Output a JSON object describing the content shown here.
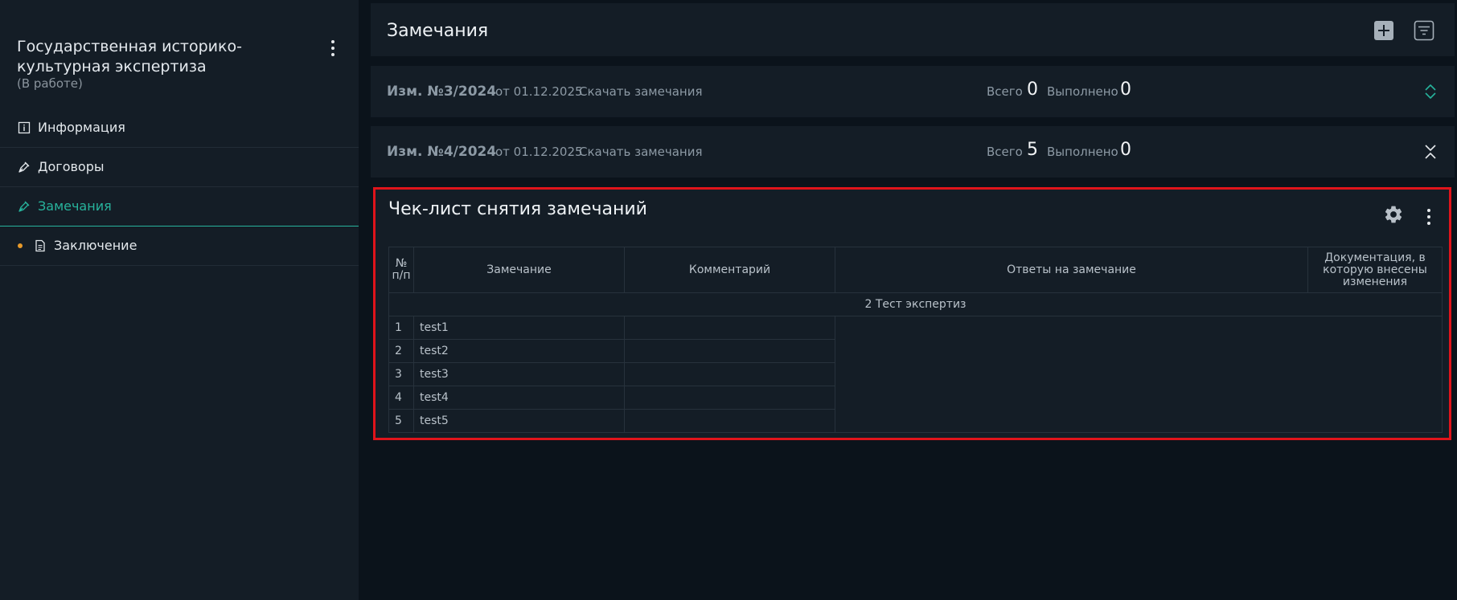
{
  "sidebar": {
    "title": "Государственная историко-культурная экспертиза",
    "status": "(В работе)",
    "menu_icon": "more-vertical-icon",
    "items": [
      {
        "label": "Информация",
        "icon": "info-icon"
      },
      {
        "label": "Договоры",
        "icon": "pen-icon"
      },
      {
        "label": "Замечания",
        "icon": "pen-icon",
        "active": true
      },
      {
        "label": "Заключение",
        "icon": "document-icon",
        "badge_color": "#e79a2a"
      }
    ]
  },
  "header": {
    "title": "Замечания",
    "add_icon": "plus-icon",
    "filter_icon": "filter-icon"
  },
  "revisions": [
    {
      "number": "Изм. №3/2024",
      "date": "от 01.12.2025",
      "download_label": "Скачать замечания",
      "total_label": "Всего",
      "total": "0",
      "done_label": "Выполнено",
      "done": "0",
      "toggle_icon": "expand-icon"
    },
    {
      "number": "Изм. №4/2024",
      "date": "от 01.12.2025",
      "download_label": "Скачать замечания",
      "total_label": "Всего",
      "total": "5",
      "done_label": "Выполнено",
      "done": "0",
      "toggle_icon": "collapse-icon"
    }
  ],
  "checklist": {
    "title": "Чек-лист снятия замечаний",
    "settings_icon": "gear-icon",
    "more_icon": "more-vertical-icon",
    "columns": [
      "№ п/п",
      "Замечание",
      "Комментарий",
      "Ответы на замечание",
      "Документация, в которую внесены изменения"
    ],
    "group": "2 Тест экспертиз",
    "rows": [
      {
        "n": "1",
        "remark": "test1"
      },
      {
        "n": "2",
        "remark": "test2"
      },
      {
        "n": "3",
        "remark": "test3"
      },
      {
        "n": "4",
        "remark": "test4"
      },
      {
        "n": "5",
        "remark": "test5"
      }
    ]
  },
  "colors": {
    "accent": "#27b39c",
    "highlight_border": "#e0141b",
    "badge": "#e79a2a"
  }
}
